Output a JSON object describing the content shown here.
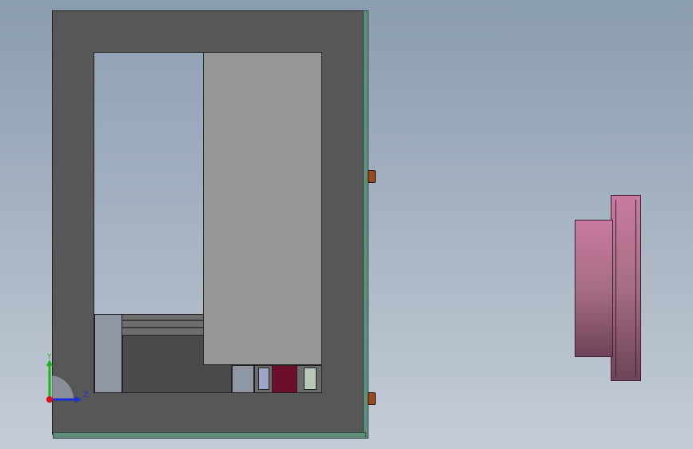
{
  "viewport": {
    "background_top": "#8a9cb0",
    "background_bottom": "#c4ccd6"
  },
  "model": {
    "frame_color": "#575757",
    "base_color": "#5f8f7a",
    "panel_color": "#969696",
    "bolt_color": "#9a4b1c",
    "flange_color": "#a66d84",
    "mechanism_accent": "#6d0f2b"
  },
  "triad": {
    "icon": "axis-triad-icon",
    "y_label": "Y",
    "z_label": "Z",
    "y_color": "#1bb51b",
    "z_color": "#1a2fd6",
    "origin_color": "#d11"
  }
}
